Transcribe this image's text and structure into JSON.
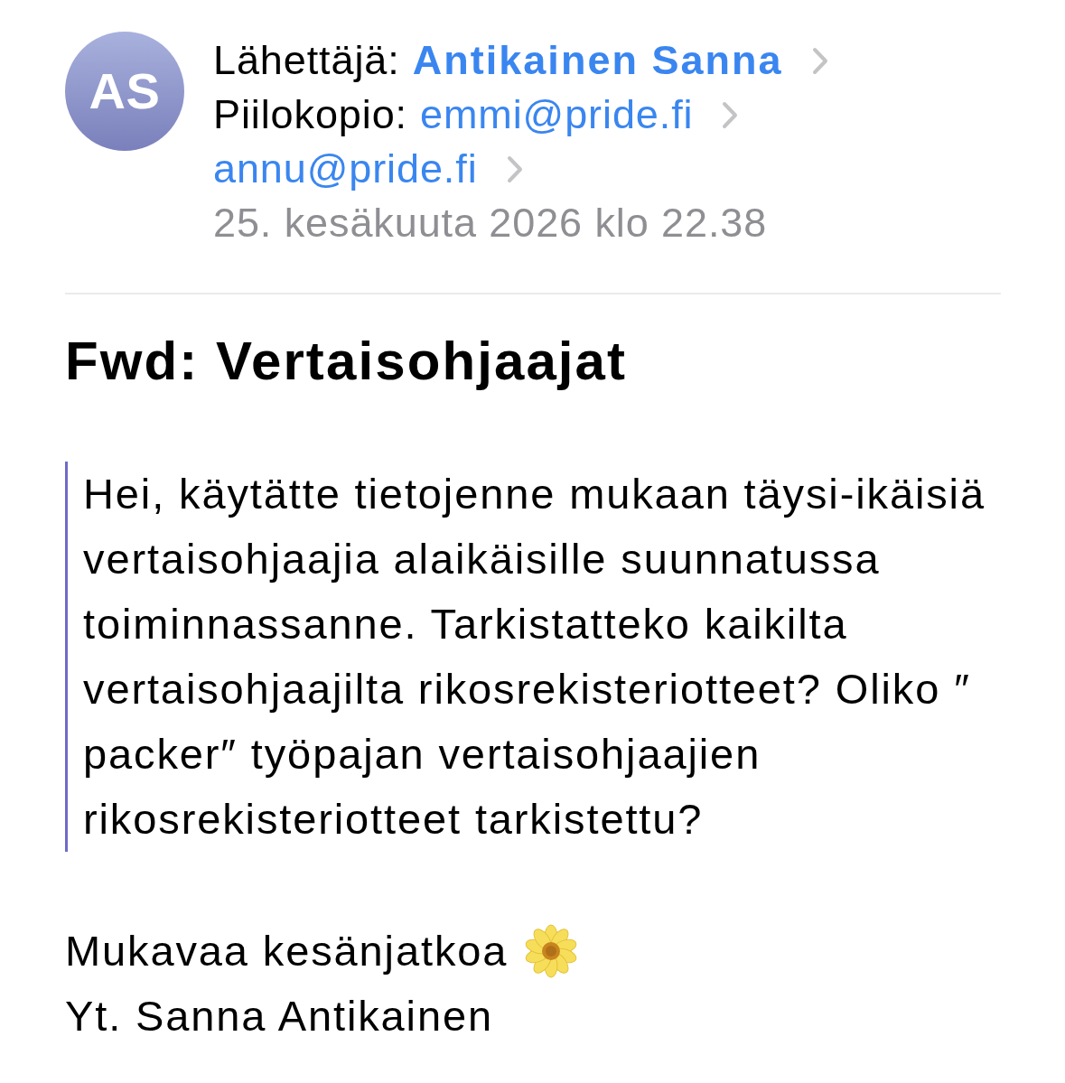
{
  "header": {
    "avatar": {
      "initials": "AS"
    },
    "sender": {
      "label": "Lähettäjä:",
      "name": "Antikainen Sanna"
    },
    "bcc": {
      "label": "Piilokopio:",
      "recipients": [
        "emmi@pride.fi",
        "annu@pride.fi"
      ]
    },
    "date": "25. kesäkuuta 2026 klo 22.38"
  },
  "subject": "Fwd: Vertaisohjaajat",
  "quote": {
    "lines": [
      "Hei, käytätte tietojenne mukaan täysi-ikäisiä",
      "vertaisohjaajia alaikäisille suunnatussa",
      "toiminnassanne. Tarkistatteko kaikilta",
      "vertaisohjaajilta rikosrekisteriotteet? Oliko ″",
      "packer″ työpajan vertaisohjaajien",
      "rikosrekisteriotteet tarkistettu?"
    ]
  },
  "closing": "Mukavaa kesänjatkoa",
  "signature": "Yt. Sanna Antikainen"
}
